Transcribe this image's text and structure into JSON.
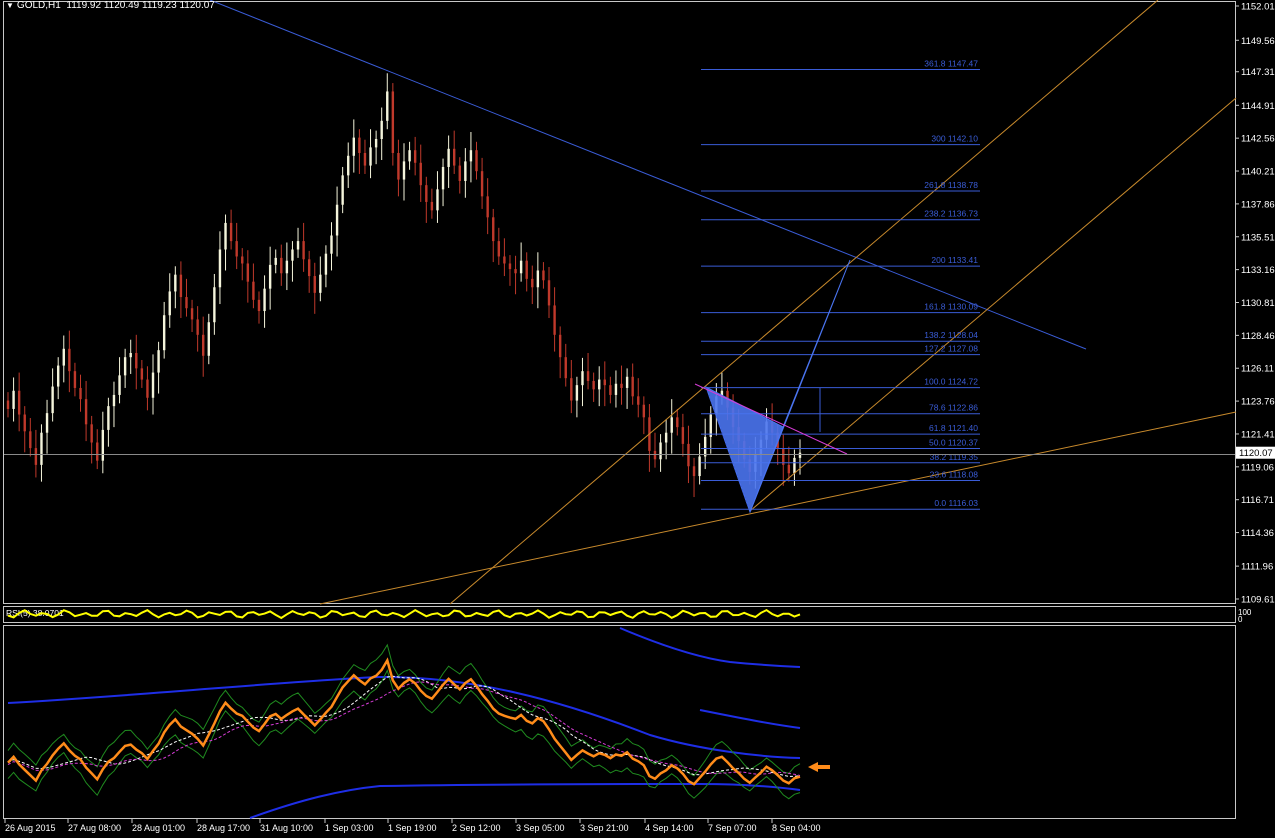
{
  "header": {
    "symbol": "GOLD,H1",
    "ohlc": "1119.92 1120.49 1119.23 1120.07",
    "arrow_icon": "triangle-down-icon"
  },
  "colors": {
    "background": "#000000",
    "grid": "#ffffff",
    "bull": "#f5f5dc",
    "bear": "#c0392b",
    "fib": "#3a5cd6",
    "trend_blue": "#3a5cd6",
    "channel": "#c88a2c",
    "pattern": "#4a74f0",
    "pattern_line": "#d63cd6",
    "rsi_yellow": "#ffff00",
    "osc_orange": "#ff8c1a",
    "osc_blue": "#1e2ee6",
    "osc_green": "#1f8a1f",
    "current_price_bg": "#ffffff"
  },
  "price_axis": {
    "labels": [
      "1152.01",
      "1149.56",
      "1147.31",
      "1144.91",
      "1142.56",
      "1140.21",
      "1137.86",
      "1135.51",
      "1133.16",
      "1130.81",
      "1128.46",
      "1126.11",
      "1123.76",
      "1121.41",
      "1119.06",
      "1116.71",
      "1114.36",
      "1111.96",
      "1109.61"
    ],
    "current": "1120.07"
  },
  "fib_levels": [
    {
      "ratio": "361.8",
      "price": "1147.47",
      "value": 1147.47
    },
    {
      "ratio": "300",
      "price": "1142.10",
      "value": 1142.1
    },
    {
      "ratio": "261.8",
      "price": "1138.78",
      "value": 1138.78
    },
    {
      "ratio": "238.2",
      "price": "1136.73",
      "value": 1136.73
    },
    {
      "ratio": "200",
      "price": "1133.41",
      "value": 1133.41
    },
    {
      "ratio": "161.8",
      "price": "1130.09",
      "value": 1130.09
    },
    {
      "ratio": "138.2",
      "price": "1128.04",
      "value": 1128.04
    },
    {
      "ratio": "127.2",
      "price": "1127.08",
      "value": 1127.08
    },
    {
      "ratio": "100.0",
      "price": "1124.72",
      "value": 1124.72
    },
    {
      "ratio": "78.6",
      "price": "1122.86",
      "value": 1122.86
    },
    {
      "ratio": "61.8",
      "price": "1121.40",
      "value": 1121.4
    },
    {
      "ratio": "50.0",
      "price": "1120.37",
      "value": 1120.37
    },
    {
      "ratio": "38.2",
      "price": "1119.35",
      "value": 1119.35
    },
    {
      "ratio": "23.6",
      "price": "1118.08",
      "value": 1118.08
    },
    {
      "ratio": "0.0",
      "price": "1116.03",
      "value": 1116.03
    }
  ],
  "rsi_panel": {
    "label": "RSI(5) 38.0701",
    "axis_top": "100",
    "axis_bottom": "0"
  },
  "time_axis": [
    "26 Aug 2015",
    "27 Aug 08:00",
    "28 Aug 01:00",
    "28 Aug 17:00",
    "31 Aug 10:00",
    "1 Sep 03:00",
    "1 Sep 19:00",
    "2 Sep 12:00",
    "3 Sep 05:00",
    "3 Sep 21:00",
    "4 Sep 14:00",
    "7 Sep 07:00",
    "8 Sep 04:00"
  ],
  "chart_data": {
    "type": "candlestick",
    "closes": [
      1123.2,
      1124.5,
      1122.8,
      1121.6,
      1120.4,
      1119.2,
      1121.5,
      1122.9,
      1124.8,
      1126.3,
      1127.5,
      1125.9,
      1124.7,
      1123.9,
      1122.1,
      1120.8,
      1119.5,
      1121.7,
      1123.4,
      1124.2,
      1125.6,
      1126.9,
      1127.2,
      1126.1,
      1125.3,
      1124.0,
      1125.8,
      1127.4,
      1129.9,
      1131.6,
      1132.8,
      1131.2,
      1130.4,
      1129.6,
      1128.5,
      1127.0,
      1129.4,
      1131.9,
      1134.6,
      1136.5,
      1135.2,
      1134.1,
      1133.6,
      1132.3,
      1131.0,
      1130.2,
      1131.8,
      1133.5,
      1134.0,
      1132.9,
      1133.8,
      1134.6,
      1135.2,
      1133.9,
      1132.7,
      1131.5,
      1132.8,
      1134.3,
      1135.6,
      1137.8,
      1139.9,
      1141.3,
      1142.6,
      1141.5,
      1140.6,
      1141.9,
      1142.5,
      1143.8,
      1145.9,
      1141.5,
      1139.6,
      1140.9,
      1141.7,
      1140.8,
      1139.2,
      1138.0,
      1137.4,
      1138.9,
      1140.5,
      1141.8,
      1140.6,
      1139.5,
      1140.9,
      1141.7,
      1140.2,
      1138.4,
      1136.9,
      1135.2,
      1134.1,
      1133.6,
      1133.2,
      1132.9,
      1133.8,
      1132.5,
      1131.9,
      1133.1,
      1132.4,
      1130.6,
      1128.5,
      1126.9,
      1125.4,
      1123.8,
      1124.9,
      1125.9,
      1125.2,
      1124.6,
      1125.3,
      1124.9,
      1124.2,
      1125.0,
      1124.7,
      1125.5,
      1124.1,
      1123.5,
      1122.6,
      1120.2,
      1119.6,
      1120.8,
      1121.5,
      1122.6,
      1121.9,
      1120.7,
      1119.1,
      1118.4,
      1119.8,
      1121.2,
      1122.8,
      1124.1,
      1124.5,
      1123.3,
      1121.9,
      1120.9,
      1119.6,
      1118.7,
      1119.9,
      1121.0,
      1122.3,
      1121.5,
      1120.4,
      1119.2,
      1118.6,
      1119.7,
      1120.07
    ],
    "fib_levels": [
      1147.47,
      1142.1,
      1138.78,
      1136.73,
      1133.41,
      1130.09,
      1128.04,
      1127.08,
      1124.72,
      1122.86,
      1121.4,
      1120.37,
      1119.35,
      1118.08,
      1116.03
    ],
    "rsi": 38.0701
  }
}
